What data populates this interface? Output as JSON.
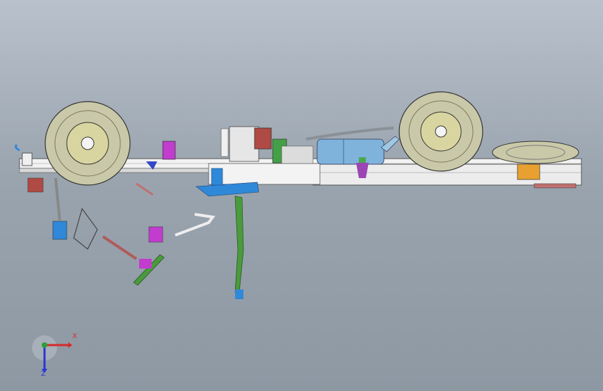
{
  "viewport": {
    "background_top": "#b9c2cc",
    "background_bottom": "#8e98a3"
  },
  "model": {
    "frame_color": "#f2f2f2",
    "tire_color": "#c9c8a8",
    "fuel_tank_color": "#7fb3dc",
    "steering_color": "#4a9b3c",
    "bracket_blue": "#2f88d8",
    "part_magenta": "#c13ccf",
    "gearbox_color": "#b04a44"
  },
  "triad": {
    "x_label": "X",
    "z_label": "Z",
    "x_color": "#d52a2a",
    "y_color": "#2aa038",
    "z_color": "#2a34d5"
  }
}
